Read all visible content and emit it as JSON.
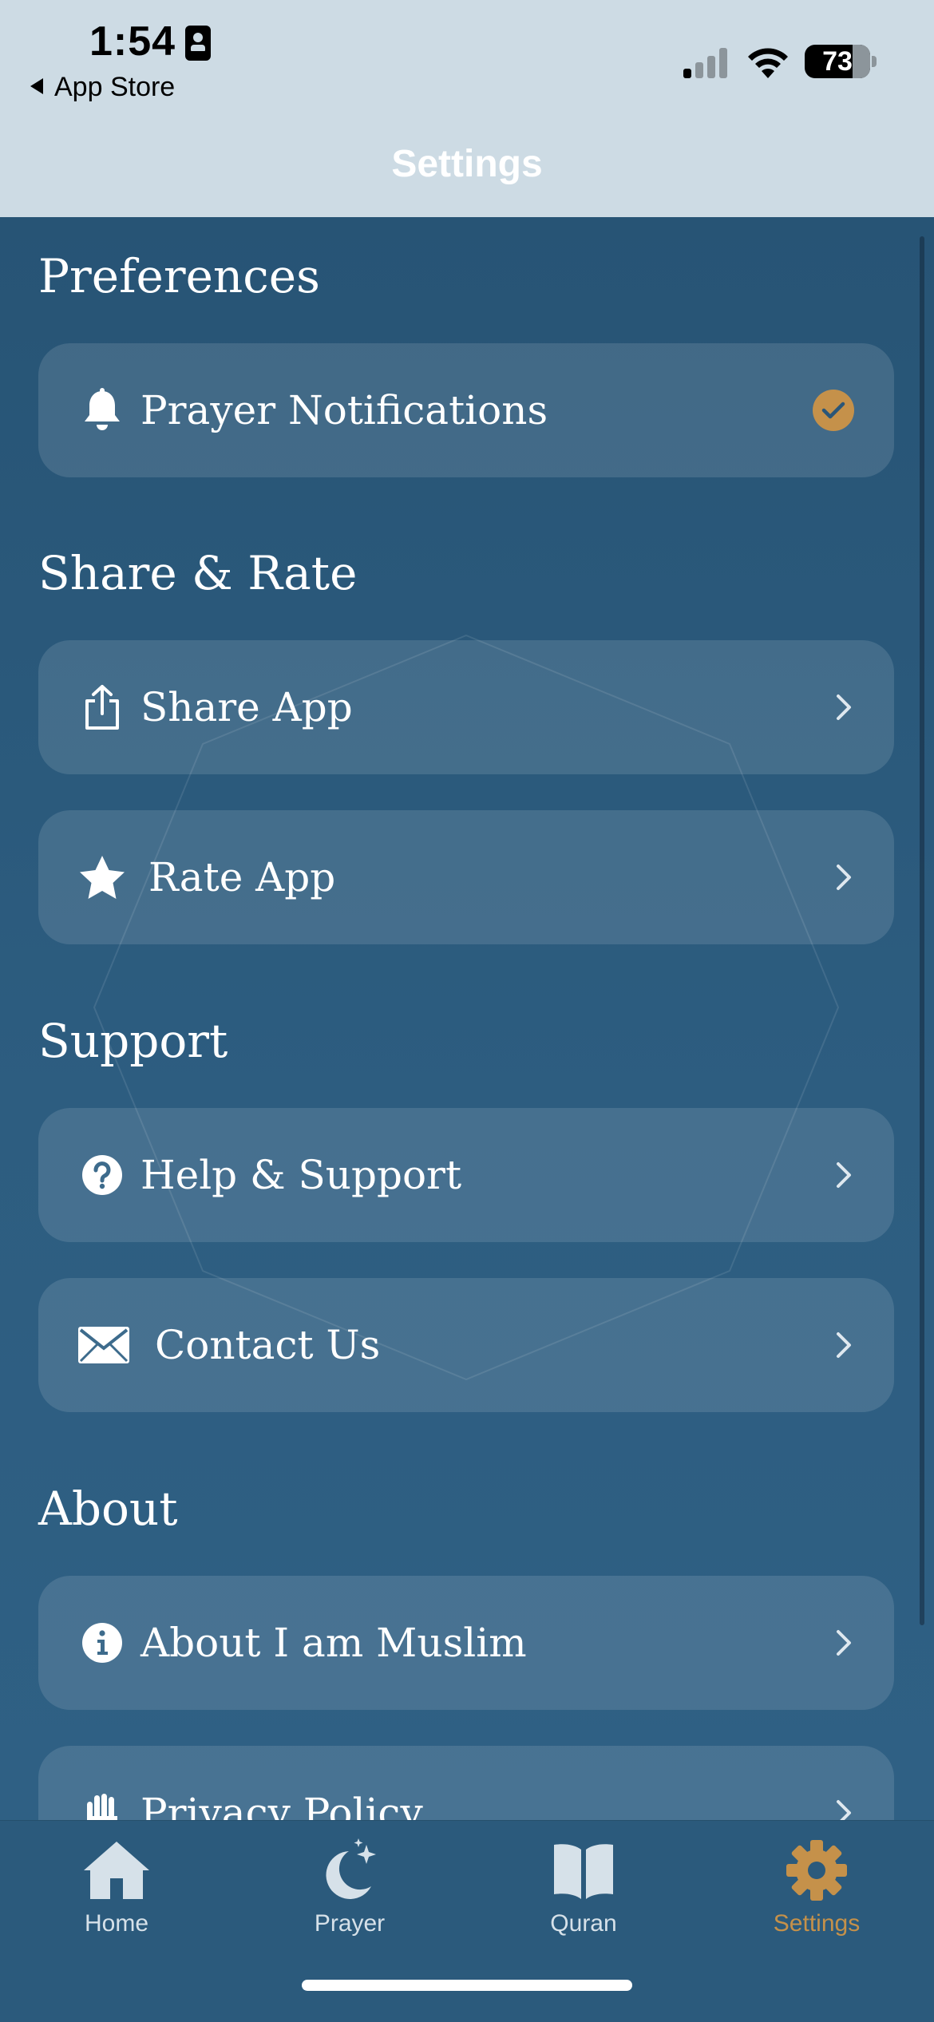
{
  "status_bar": {
    "time": "1:54",
    "back_app": "App Store",
    "battery": "73"
  },
  "header": {
    "title": "Settings"
  },
  "sections": [
    {
      "title": "Preferences",
      "rows": [
        {
          "label": "Prayer Notifications",
          "icon": "bell-icon",
          "accessory": "checkmark"
        }
      ]
    },
    {
      "title": "Share & Rate",
      "rows": [
        {
          "label": "Share App",
          "icon": "share-icon",
          "accessory": "chevron"
        },
        {
          "label": "Rate App",
          "icon": "star-icon",
          "accessory": "chevron"
        }
      ]
    },
    {
      "title": "Support",
      "rows": [
        {
          "label": "Help & Support",
          "icon": "question-circle-icon",
          "accessory": "chevron"
        },
        {
          "label": "Contact Us",
          "icon": "envelope-icon",
          "accessory": "chevron"
        }
      ]
    },
    {
      "title": "About",
      "rows": [
        {
          "label": "About I am Muslim",
          "icon": "info-circle-icon",
          "accessory": "chevron"
        },
        {
          "label": "Privacy Policy",
          "icon": "hand-icon",
          "accessory": "chevron"
        }
      ]
    }
  ],
  "tabs": [
    {
      "label": "Home",
      "icon": "house-icon",
      "active": false
    },
    {
      "label": "Prayer",
      "icon": "moon-stars-icon",
      "active": false
    },
    {
      "label": "Quran",
      "icon": "open-book-icon",
      "active": false
    },
    {
      "label": "Settings",
      "icon": "gear-icon",
      "active": true
    }
  ],
  "colors": {
    "background": "#2a5678",
    "status_bar": "#cddbe4",
    "accent": "#c5914a",
    "row_fill": "rgba(255,255,255,0.12)"
  }
}
